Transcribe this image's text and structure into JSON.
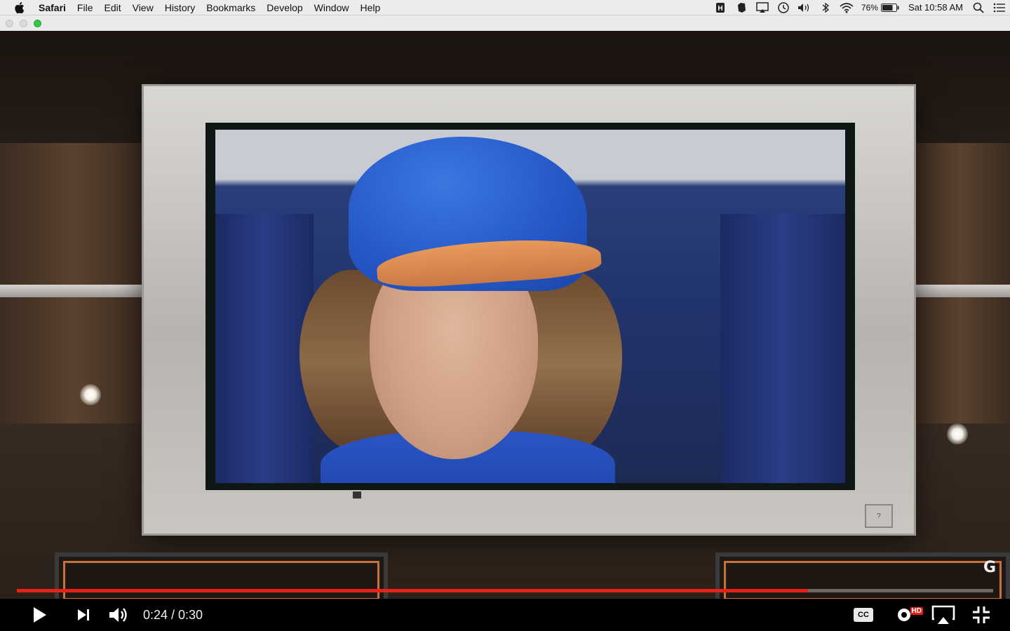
{
  "menubar": {
    "app_name": "Safari",
    "items": [
      "File",
      "Edit",
      "View",
      "History",
      "Bookmarks",
      "Develop",
      "Window",
      "Help"
    ],
    "status_icons": [
      "h-icon",
      "evernote-icon",
      "airplay-icon",
      "time-machine-icon",
      "volume-icon",
      "bluetooth-icon",
      "wifi-icon"
    ],
    "battery_percent": "76%",
    "clock": "Sat 10:58 AM"
  },
  "player": {
    "current_time": "0:24",
    "duration": "0:30",
    "time_display": "0:24 / 0:30",
    "progress_fraction": 0.81,
    "buttons": {
      "cc": "CC",
      "hd": "HD"
    },
    "watermark": "G"
  },
  "colors": {
    "progress_played": "#e62117",
    "hd_badge": "#e62117",
    "zoom_button": "#33c748"
  }
}
